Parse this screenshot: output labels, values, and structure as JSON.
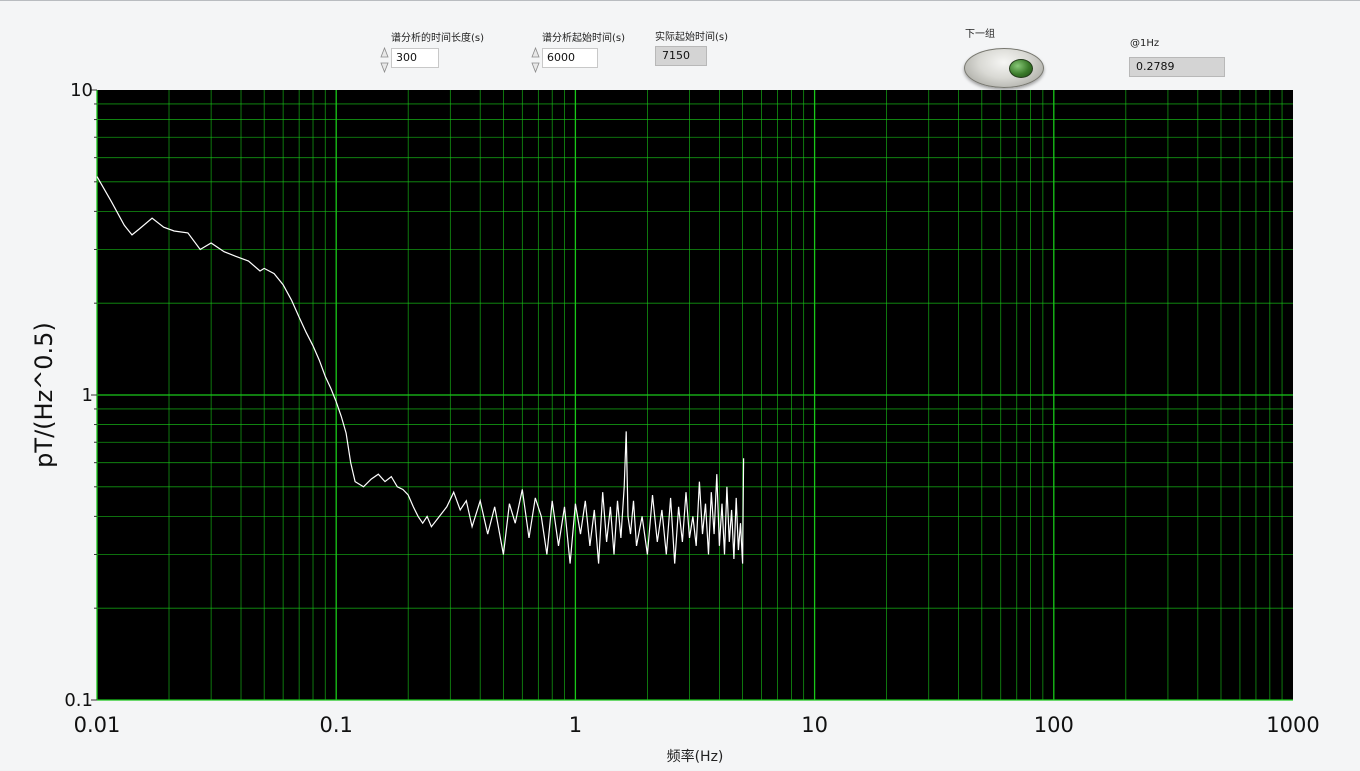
{
  "controls": {
    "duration": {
      "label": "谱分析的时间长度(s)",
      "value": "300"
    },
    "start_time": {
      "label": "谱分析起始时间(s)",
      "value": "6000"
    },
    "actual_start": {
      "label": "实际起始时间(s)",
      "value": "7150"
    },
    "next_button": {
      "label": "下一组"
    },
    "at_1hz": {
      "label": "@1Hz",
      "value": "0.2789"
    }
  },
  "colors": {
    "plot_bg": "#000000",
    "grid": "#19c819",
    "trace": "#ffffff"
  },
  "chart_data": {
    "type": "line",
    "title": "",
    "xlabel": "频率(Hz)",
    "ylabel": "pT/(Hz^0.5)",
    "xscale": "log",
    "yscale": "log",
    "xlim": [
      0.01,
      1000
    ],
    "ylim": [
      0.1,
      10
    ],
    "grid": true,
    "xticks": [
      {
        "value": 0.01,
        "label": "0.01"
      },
      {
        "value": 0.1,
        "label": "0.1"
      },
      {
        "value": 1,
        "label": "1"
      },
      {
        "value": 10,
        "label": "10"
      },
      {
        "value": 100,
        "label": "100"
      },
      {
        "value": 1000,
        "label": "1000"
      }
    ],
    "yticks": [
      {
        "value": 0.1,
        "label": "0.1"
      },
      {
        "value": 1,
        "label": "1"
      },
      {
        "value": 10,
        "label": "10"
      }
    ],
    "series": [
      {
        "x": [
          0.01,
          0.0115,
          0.013,
          0.014,
          0.015,
          0.017,
          0.019,
          0.021,
          0.024,
          0.027,
          0.03,
          0.034,
          0.038,
          0.043,
          0.048,
          0.05,
          0.055,
          0.06,
          0.065,
          0.07,
          0.075,
          0.08,
          0.085,
          0.09,
          0.095,
          0.1,
          0.105,
          0.11,
          0.115,
          0.12,
          0.13,
          0.14,
          0.15,
          0.16,
          0.17,
          0.18,
          0.19,
          0.2,
          0.21,
          0.22,
          0.23,
          0.24,
          0.25,
          0.27,
          0.29,
          0.31,
          0.33,
          0.35,
          0.37,
          0.4,
          0.43,
          0.46,
          0.5,
          0.53,
          0.56,
          0.6,
          0.64,
          0.68,
          0.72,
          0.76,
          0.8,
          0.85,
          0.9,
          0.95,
          1.0,
          1.05,
          1.1,
          1.15,
          1.2,
          1.25,
          1.3,
          1.35,
          1.4,
          1.45,
          1.5,
          1.55,
          1.6,
          1.63,
          1.66,
          1.7,
          1.75,
          1.8,
          1.9,
          2.0,
          2.1,
          2.2,
          2.3,
          2.4,
          2.5,
          2.6,
          2.7,
          2.8,
          2.9,
          3.0,
          3.1,
          3.2,
          3.3,
          3.4,
          3.5,
          3.6,
          3.7,
          3.8,
          3.9,
          4.0,
          4.1,
          4.2,
          4.3,
          4.4,
          4.5,
          4.6,
          4.7,
          4.8,
          4.9,
          5.0,
          5.05
        ],
        "y": [
          5.2,
          4.3,
          3.6,
          3.35,
          3.5,
          3.8,
          3.55,
          3.45,
          3.4,
          3.0,
          3.15,
          2.95,
          2.85,
          2.75,
          2.55,
          2.6,
          2.5,
          2.3,
          2.05,
          1.8,
          1.6,
          1.45,
          1.3,
          1.15,
          1.05,
          0.95,
          0.85,
          0.75,
          0.6,
          0.52,
          0.5,
          0.53,
          0.55,
          0.52,
          0.54,
          0.5,
          0.49,
          0.47,
          0.43,
          0.4,
          0.38,
          0.4,
          0.37,
          0.4,
          0.43,
          0.48,
          0.42,
          0.45,
          0.37,
          0.45,
          0.35,
          0.43,
          0.3,
          0.44,
          0.38,
          0.49,
          0.34,
          0.46,
          0.4,
          0.3,
          0.45,
          0.32,
          0.43,
          0.28,
          0.44,
          0.35,
          0.45,
          0.32,
          0.42,
          0.28,
          0.48,
          0.33,
          0.43,
          0.3,
          0.45,
          0.34,
          0.5,
          0.76,
          0.4,
          0.35,
          0.45,
          0.32,
          0.4,
          0.3,
          0.47,
          0.33,
          0.42,
          0.3,
          0.46,
          0.28,
          0.43,
          0.33,
          0.48,
          0.34,
          0.4,
          0.32,
          0.52,
          0.35,
          0.44,
          0.3,
          0.48,
          0.35,
          0.55,
          0.32,
          0.44,
          0.3,
          0.5,
          0.33,
          0.42,
          0.29,
          0.46,
          0.31,
          0.38,
          0.28,
          0.62
        ]
      }
    ]
  }
}
